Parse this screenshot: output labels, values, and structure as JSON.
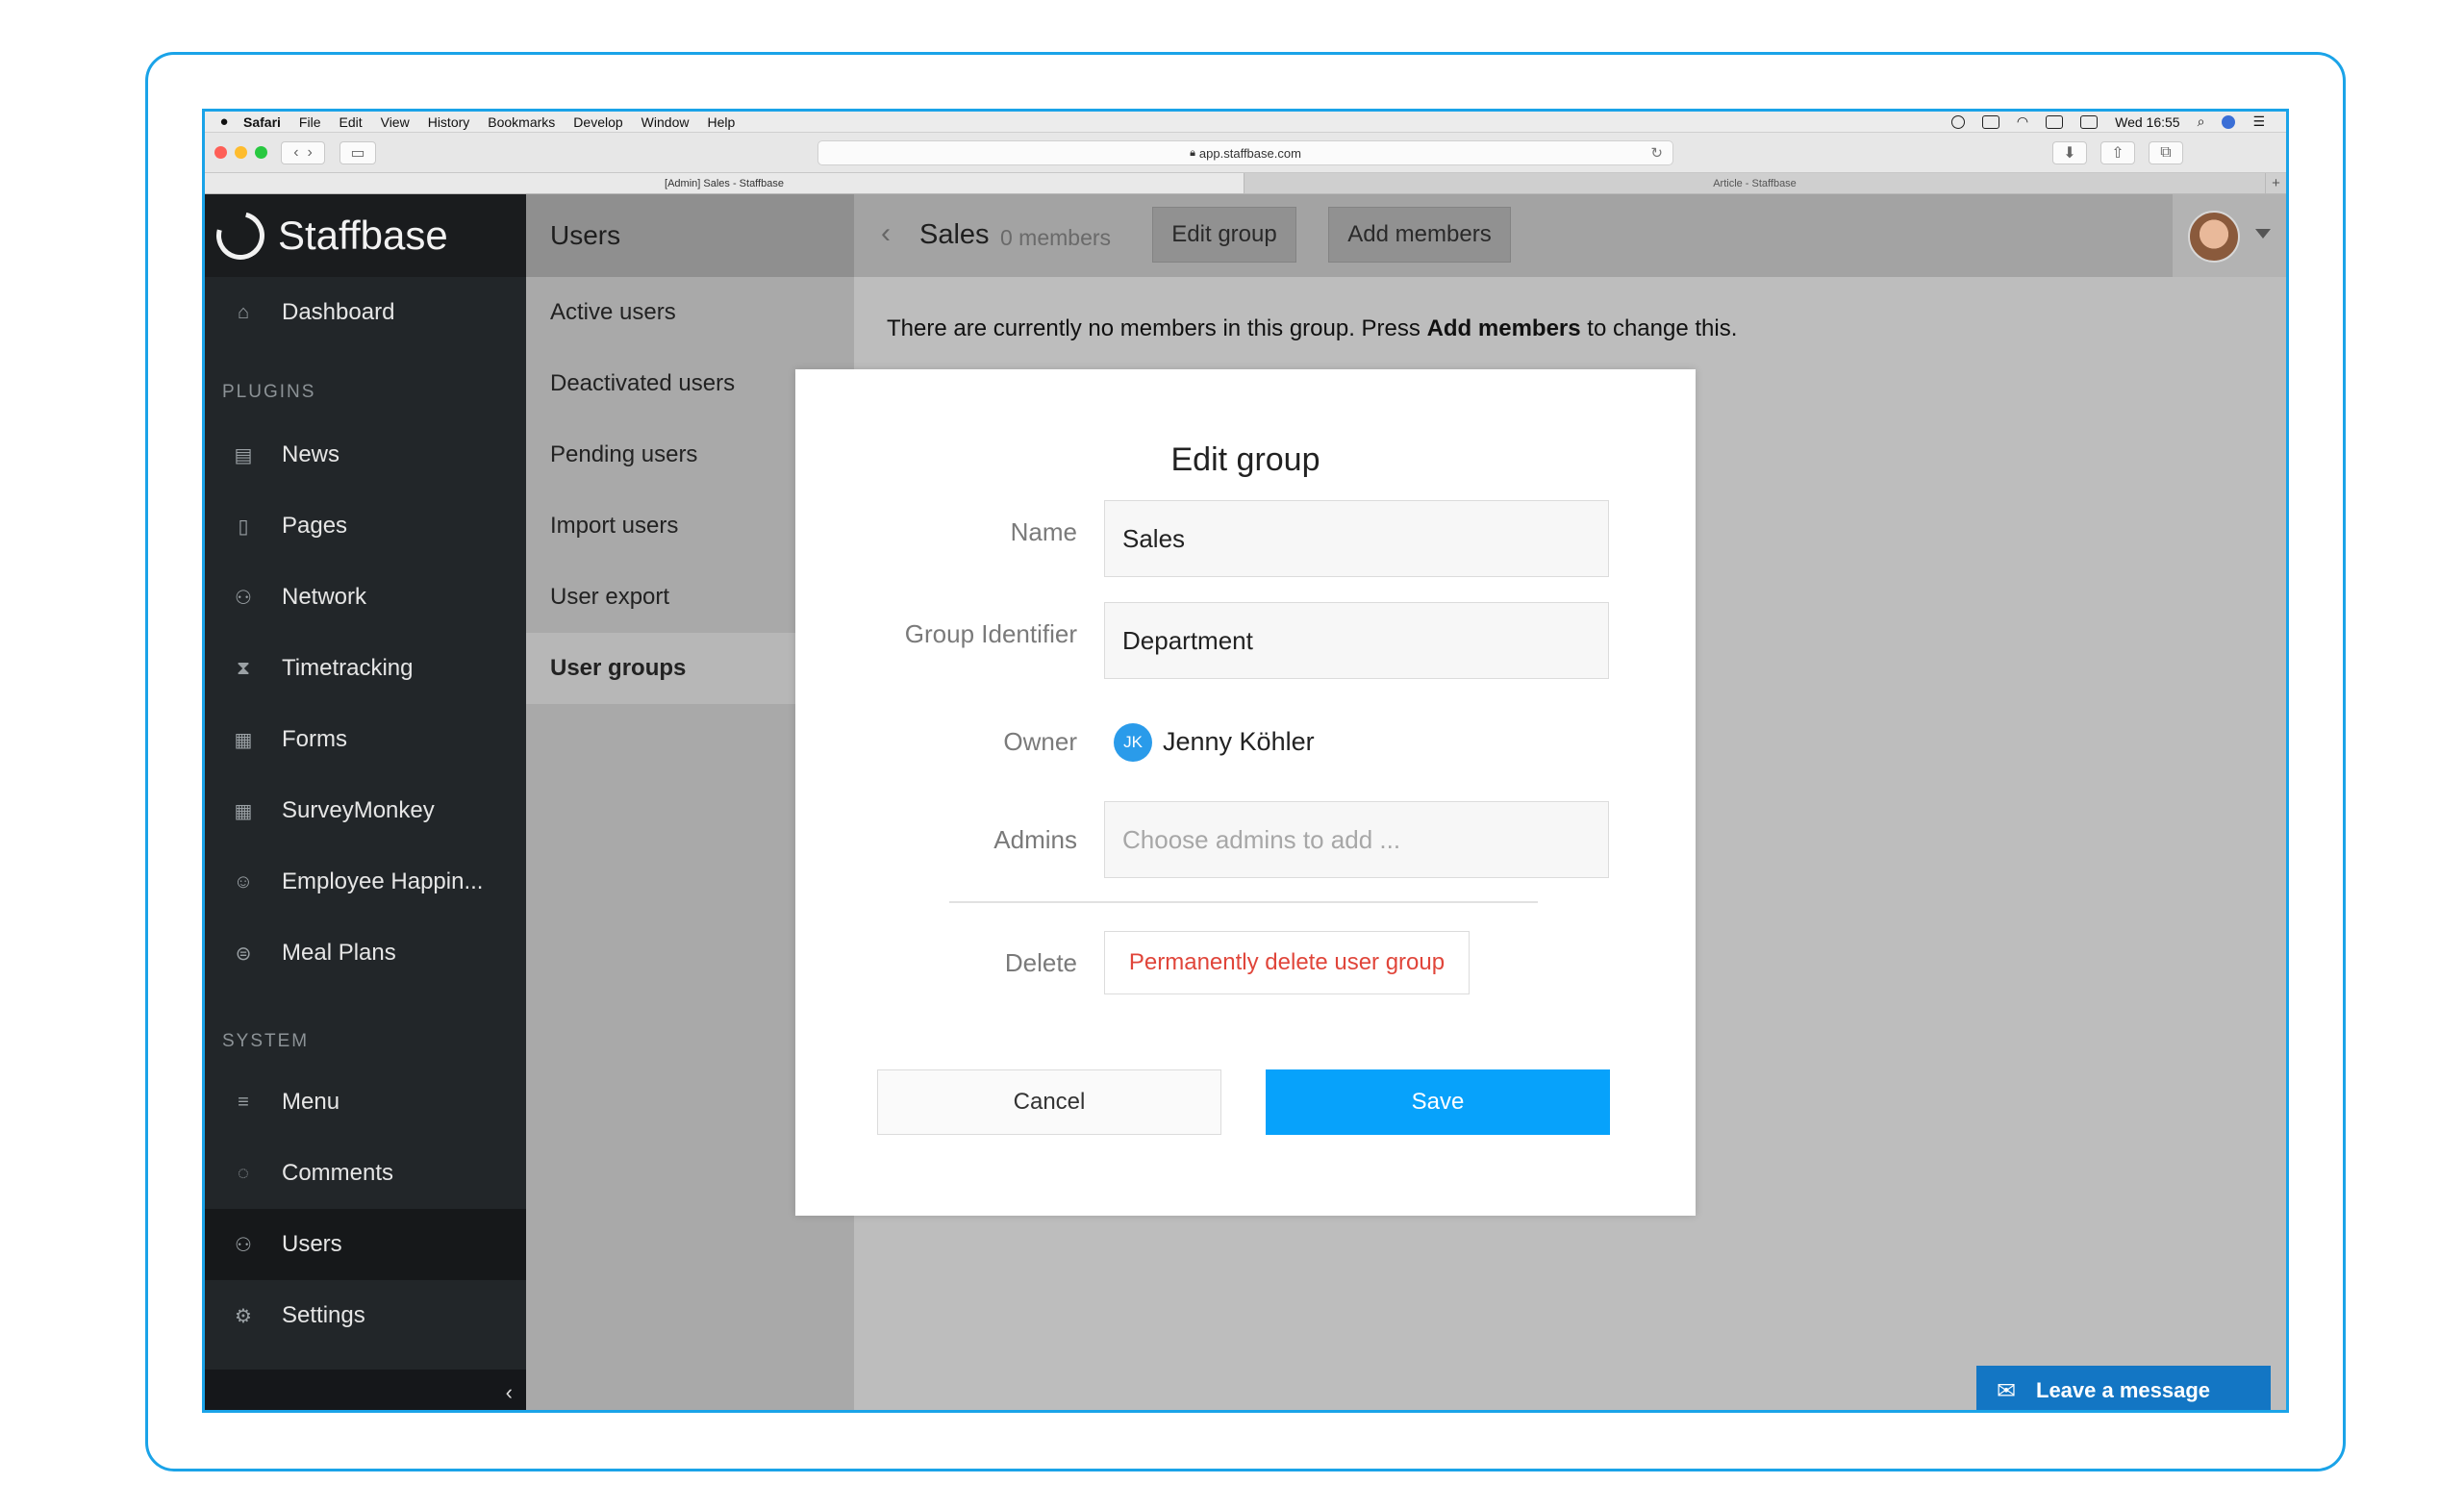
{
  "menubar": {
    "apple": "",
    "items": [
      "Safari",
      "File",
      "Edit",
      "View",
      "History",
      "Bookmarks",
      "Develop",
      "Window",
      "Help"
    ],
    "clock": "Wed 16:55"
  },
  "browser": {
    "url": "app.staffbase.com",
    "tabs": [
      "[Admin] Sales - Staffbase",
      "Article - Staffbase"
    ],
    "new_tab": "+"
  },
  "sidebar": {
    "brand": "Staffbase",
    "dashboard": "Dashboard",
    "plugins_heading": "PLUGINS",
    "plugins": [
      "News",
      "Pages",
      "Network",
      "Timetracking",
      "Forms",
      "SurveyMonkey",
      "Employee Happin...",
      "Meal Plans"
    ],
    "system_heading": "SYSTEM",
    "system": [
      "Menu",
      "Comments",
      "Users",
      "Settings"
    ],
    "collapse": "‹"
  },
  "subnav": {
    "title": "Users",
    "items": [
      "Active users",
      "Deactivated users",
      "Pending users",
      "Import users",
      "User export",
      "User groups"
    ]
  },
  "group": {
    "title": "Sales",
    "count": "0 members",
    "edit_label": "Edit group",
    "add_label": "Add members",
    "notice_before": "There are currently no members in this group. Press ",
    "notice_bold": "Add members",
    "notice_after": " to change this."
  },
  "modal": {
    "title": "Edit group",
    "name_label": "Name",
    "name_value": "Sales",
    "identifier_label": "Group Identifier",
    "identifier_value": "Department",
    "owner_label": "Owner",
    "owner_initials": "JK",
    "owner_name": "Jenny Köhler",
    "admins_label": "Admins",
    "admins_placeholder": "Choose admins to add ...",
    "delete_label": "Delete",
    "delete_button": "Permanently delete user group",
    "cancel": "Cancel",
    "save": "Save"
  },
  "chat": {
    "label": "Leave a message"
  },
  "colors": {
    "accent": "#07a2fb",
    "danger": "#e0453a",
    "chat": "#1376c4",
    "frame": "#1aa3e8"
  }
}
